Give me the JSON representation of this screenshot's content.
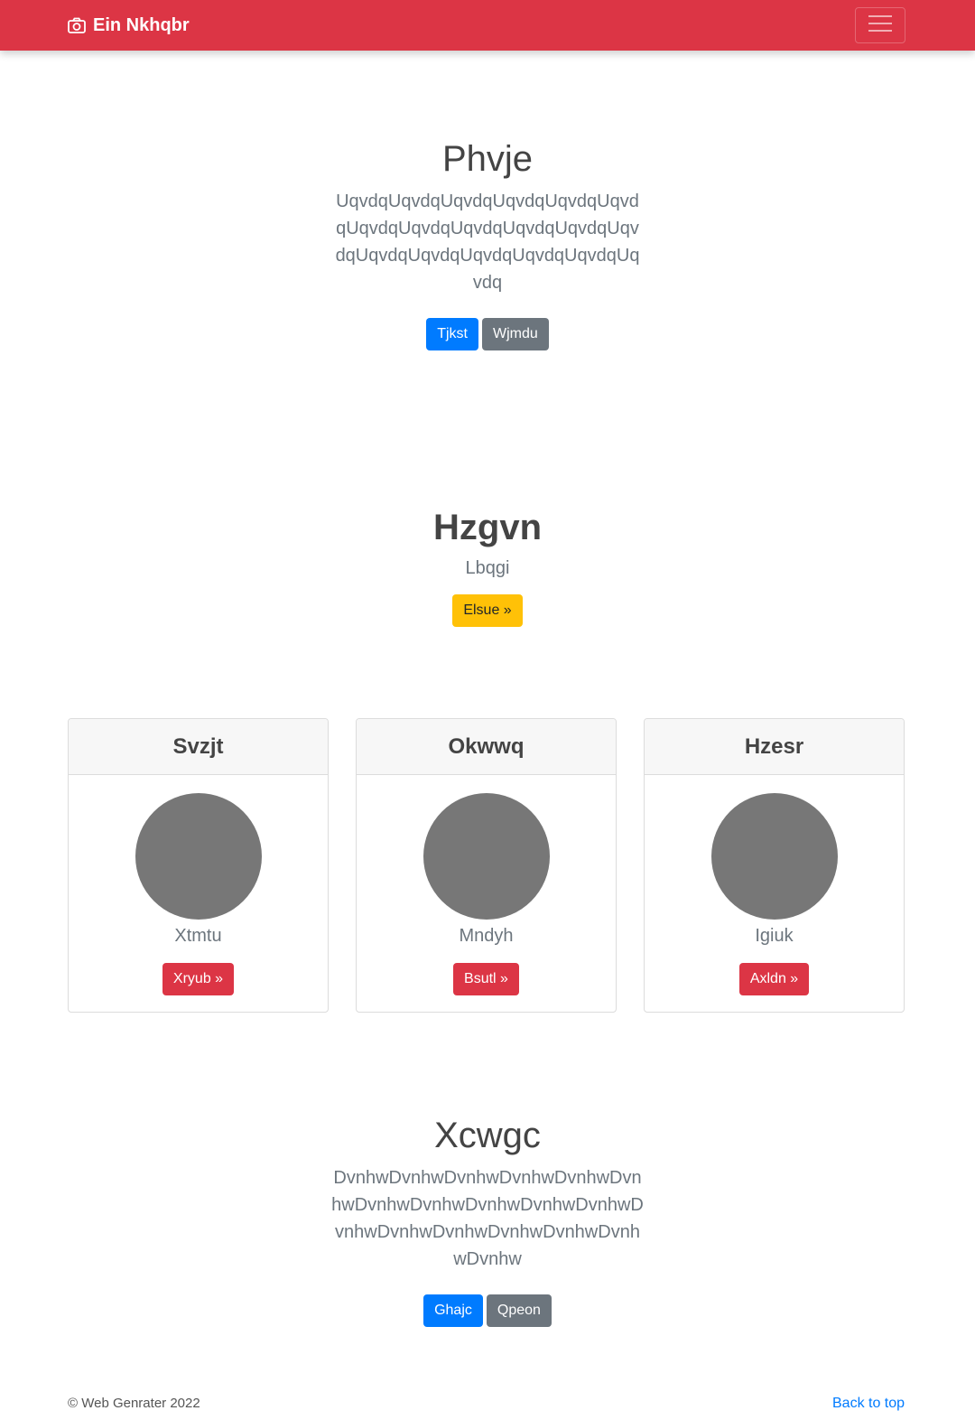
{
  "navbar": {
    "brand_icon": "camera-icon",
    "brand_text": "Ein Nkhqbr",
    "toggler_icon": "hamburger-menu-icon",
    "color": "#dc3545"
  },
  "hero": {
    "title": "Phvje",
    "lead": "UqvdqUqvdqUqvdqUqvdqUqvdqUqvdqUqvdqUqvdqUqvdqUqvdqUqvdqUqvdqUqvdqUqvdqUqvdqUqvdqUqvdqUqvdq",
    "primary_button": "Tjkst",
    "secondary_button": "Wjmdu"
  },
  "feature": {
    "title": "Hzgvn",
    "subtitle": "Lbqgi",
    "button": "Elsue »"
  },
  "cards": [
    {
      "header": "Svzjt",
      "text": "Xtmtu",
      "button": "Xryub »"
    },
    {
      "header": "Okwwq",
      "text": "Mndyh",
      "button": "Bsutl »"
    },
    {
      "header": "Hzesr",
      "text": "Igiuk",
      "button": "Axldn »"
    }
  ],
  "section2": {
    "title": "Xcwgc",
    "lead": "DvnhwDvnhwDvnhwDvnhwDvnhwDvnhwDvnhwDvnhwDvnhwDvnhwDvnhwDvnhwDvnhwDvnhwDvnhwDvnhwDvnhwDvnhw",
    "primary_button": "Ghajc",
    "secondary_button": "Qpeon"
  },
  "footer": {
    "copyright": "© Web Genrater 2022",
    "back_to_top": "Back to top"
  },
  "colors": {
    "primary": "#007bff",
    "secondary": "#6c757d",
    "warning": "#ffc107",
    "danger": "#dc3545"
  }
}
